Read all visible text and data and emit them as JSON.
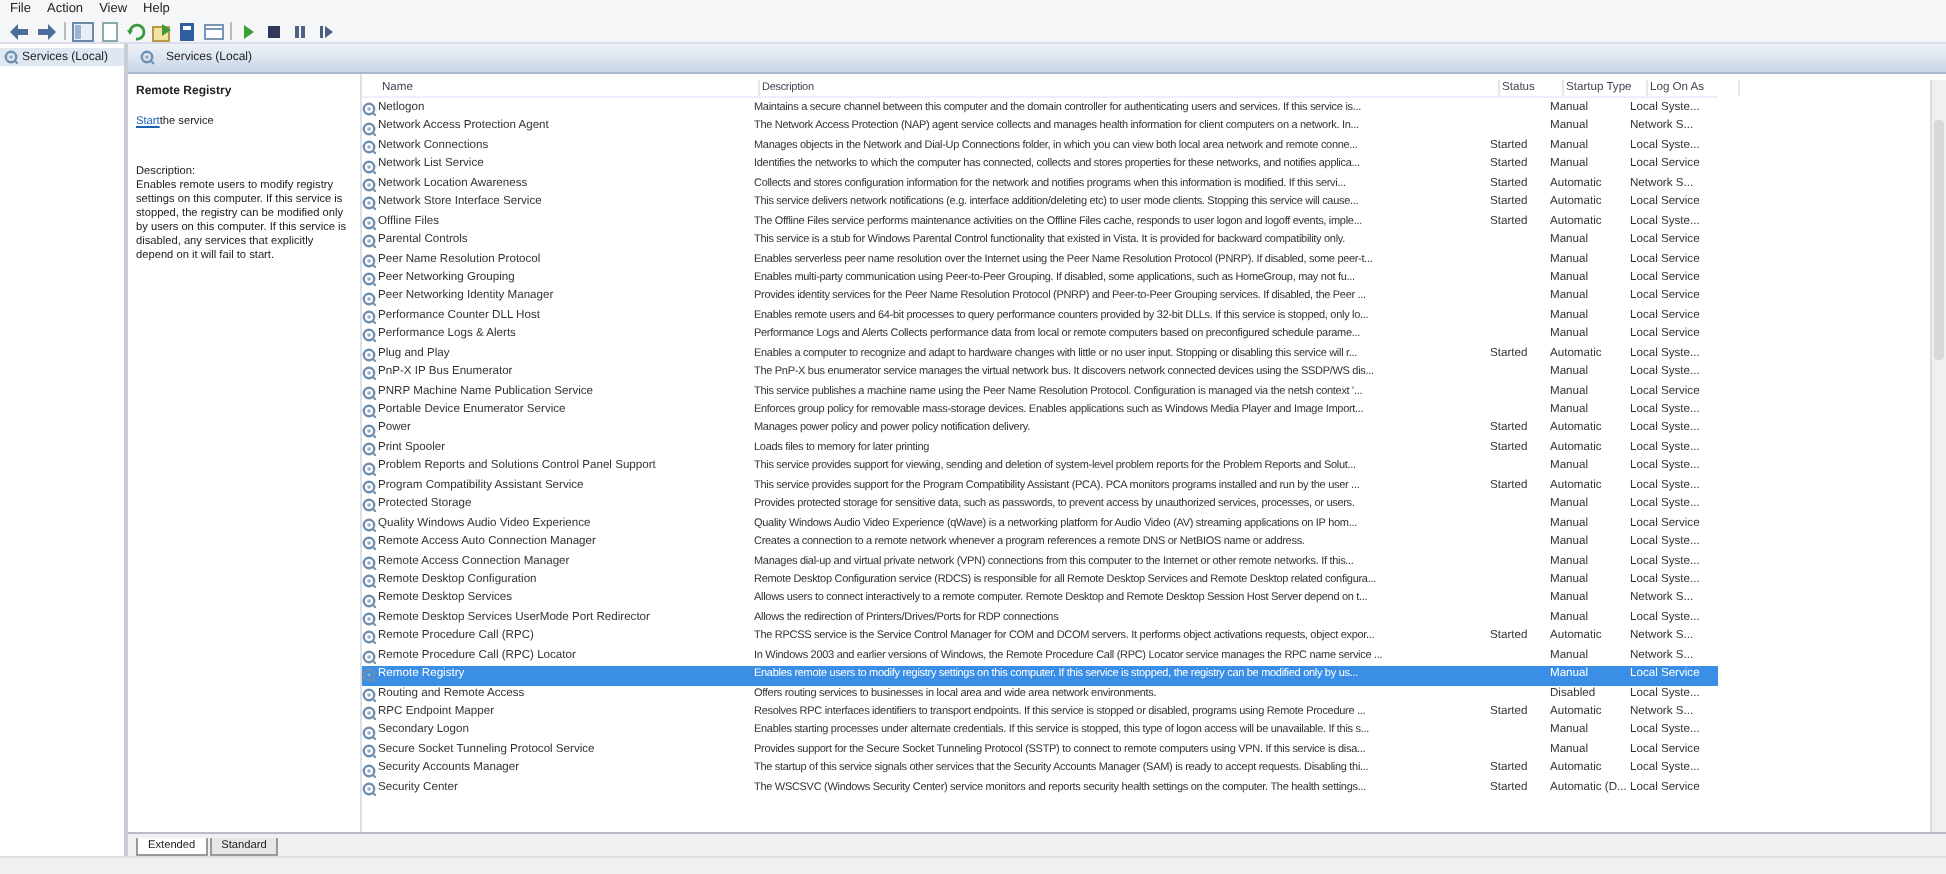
{
  "menu": [
    "File",
    "Action",
    "View",
    "Help"
  ],
  "tree": {
    "label": "Services (Local)",
    "selected": true
  },
  "panel_title": "Services (Local)",
  "details": {
    "title": "Remote Registry",
    "link_prefix": "Start",
    "link_rest": " the service",
    "description_label": "Description:",
    "description": "Enables remote users to modify registry settings on this computer. If this service is stopped, the registry can be modified only by users on this computer. If this service is disabled, any services that explicitly depend on it will fail to start."
  },
  "table": {
    "columns": [
      "Name",
      "Description",
      "Status",
      "Startup Type",
      "Log On As"
    ],
    "rows": [
      {
        "name": "Netlogon",
        "description": "Maintains a secure channel between this computer and the domain controller for authenticating users and services. If this service is...",
        "status": "",
        "startup": "Manual",
        "logon": "Local Syste...",
        "selected": false
      },
      {
        "name": "Network Access Protection Agent",
        "description": "The Network Access Protection (NAP) agent service collects and manages health information for client computers on a network. In...",
        "status": "",
        "startup": "Manual",
        "logon": "Network S...",
        "selected": false
      },
      {
        "name": "Network Connections",
        "description": "Manages objects in the Network and Dial-Up Connections folder, in which you can view both local area network and remote conne...",
        "status": "Started",
        "startup": "Manual",
        "logon": "Local Syste...",
        "selected": false
      },
      {
        "name": "Network List Service",
        "description": "Identifies the networks to which the computer has connected, collects and stores properties for these networks, and notifies applica...",
        "status": "Started",
        "startup": "Manual",
        "logon": "Local Service",
        "selected": false
      },
      {
        "name": "Network Location Awareness",
        "description": "Collects and stores configuration information for the network and notifies programs when this information is modified. If this servi...",
        "status": "Started",
        "startup": "Automatic",
        "logon": "Network S...",
        "selected": false
      },
      {
        "name": "Network Store Interface Service",
        "description": "This service delivers network notifications (e.g. interface addition/deleting etc) to user mode clients. Stopping this service will cause...",
        "status": "Started",
        "startup": "Automatic",
        "logon": "Local Service",
        "selected": false
      },
      {
        "name": "Offline Files",
        "description": "The Offline Files service performs maintenance activities on the Offline Files cache, responds to user logon and logoff events, imple...",
        "status": "Started",
        "startup": "Automatic",
        "logon": "Local Syste...",
        "selected": false
      },
      {
        "name": "Parental Controls",
        "description": "This service is a stub for Windows Parental Control functionality that existed in Vista. It is provided for backward compatibility only.",
        "status": "",
        "startup": "Manual",
        "logon": "Local Service",
        "selected": false
      },
      {
        "name": "Peer Name Resolution Protocol",
        "description": "Enables serverless peer name resolution over the Internet using the Peer Name Resolution Protocol (PNRP). If disabled, some peer-t...",
        "status": "",
        "startup": "Manual",
        "logon": "Local Service",
        "selected": false
      },
      {
        "name": "Peer Networking Grouping",
        "description": "Enables multi-party communication using Peer-to-Peer Grouping. If disabled, some applications, such as HomeGroup, may not fu...",
        "status": "",
        "startup": "Manual",
        "logon": "Local Service",
        "selected": false
      },
      {
        "name": "Peer Networking Identity Manager",
        "description": "Provides identity services for the Peer Name Resolution Protocol (PNRP) and Peer-to-Peer Grouping services. If disabled, the Peer ...",
        "status": "",
        "startup": "Manual",
        "logon": "Local Service",
        "selected": false
      },
      {
        "name": "Performance Counter DLL Host",
        "description": "Enables remote users and 64-bit processes to query performance counters provided by 32-bit DLLs. If this service is stopped, only lo...",
        "status": "",
        "startup": "Manual",
        "logon": "Local Service",
        "selected": false
      },
      {
        "name": "Performance Logs & Alerts",
        "description": "Performance Logs and Alerts Collects performance data from local or remote computers based on preconfigured schedule parame...",
        "status": "",
        "startup": "Manual",
        "logon": "Local Service",
        "selected": false
      },
      {
        "name": "Plug and Play",
        "description": "Enables a computer to recognize and adapt to hardware changes with little or no user input. Stopping or disabling this service will r...",
        "status": "Started",
        "startup": "Automatic",
        "logon": "Local Syste...",
        "selected": false
      },
      {
        "name": "PnP-X IP Bus Enumerator",
        "description": "The PnP-X bus enumerator service manages the virtual network bus. It discovers network connected devices using the SSDP/WS dis...",
        "status": "",
        "startup": "Manual",
        "logon": "Local Syste...",
        "selected": false
      },
      {
        "name": "PNRP Machine Name Publication Service",
        "description": "This service publishes a machine name using the Peer Name Resolution Protocol. Configuration is managed via the netsh context '...",
        "status": "",
        "startup": "Manual",
        "logon": "Local Service",
        "selected": false
      },
      {
        "name": "Portable Device Enumerator Service",
        "description": "Enforces group policy for removable mass-storage devices. Enables applications such as Windows Media Player and Image Import...",
        "status": "",
        "startup": "Manual",
        "logon": "Local Syste...",
        "selected": false
      },
      {
        "name": "Power",
        "description": "Manages power policy and power policy notification delivery.",
        "status": "Started",
        "startup": "Automatic",
        "logon": "Local Syste...",
        "selected": false
      },
      {
        "name": "Print Spooler",
        "description": "Loads files to memory for later printing",
        "status": "Started",
        "startup": "Automatic",
        "logon": "Local Syste...",
        "selected": false
      },
      {
        "name": "Problem Reports and Solutions Control Panel Support",
        "description": "This service provides support for viewing, sending and deletion of system-level problem reports for the Problem Reports and Solut...",
        "status": "",
        "startup": "Manual",
        "logon": "Local Syste...",
        "selected": false
      },
      {
        "name": "Program Compatibility Assistant Service",
        "description": "This service provides support for the Program Compatibility Assistant (PCA). PCA monitors programs installed and run by the user ...",
        "status": "Started",
        "startup": "Automatic",
        "logon": "Local Syste...",
        "selected": false
      },
      {
        "name": "Protected Storage",
        "description": "Provides protected storage for sensitive data, such as passwords, to prevent access by unauthorized services, processes, or users.",
        "status": "",
        "startup": "Manual",
        "logon": "Local Syste...",
        "selected": false
      },
      {
        "name": "Quality Windows Audio Video Experience",
        "description": "Quality Windows Audio Video Experience (qWave) is a networking platform for Audio Video (AV) streaming applications on IP hom...",
        "status": "",
        "startup": "Manual",
        "logon": "Local Service",
        "selected": false
      },
      {
        "name": "Remote Access Auto Connection Manager",
        "description": "Creates a connection to a remote network whenever a program references a remote DNS or NetBIOS name or address.",
        "status": "",
        "startup": "Manual",
        "logon": "Local Syste...",
        "selected": false
      },
      {
        "name": "Remote Access Connection Manager",
        "description": "Manages dial-up and virtual private network (VPN) connections from this computer to the Internet or other remote networks. If this...",
        "status": "",
        "startup": "Manual",
        "logon": "Local Syste...",
        "selected": false
      },
      {
        "name": "Remote Desktop Configuration",
        "description": "Remote Desktop Configuration service (RDCS) is responsible for all Remote Desktop Services and Remote Desktop related configura...",
        "status": "",
        "startup": "Manual",
        "logon": "Local Syste...",
        "selected": false
      },
      {
        "name": "Remote Desktop Services",
        "description": "Allows users to connect interactively to a remote computer. Remote Desktop and Remote Desktop Session Host Server depend on t...",
        "status": "",
        "startup": "Manual",
        "logon": "Network S...",
        "selected": false
      },
      {
        "name": "Remote Desktop Services UserMode Port Redirector",
        "description": "Allows the redirection of Printers/Drives/Ports for RDP connections",
        "status": "",
        "startup": "Manual",
        "logon": "Local Syste...",
        "selected": false
      },
      {
        "name": "Remote Procedure Call (RPC)",
        "description": "The RPCSS service is the Service Control Manager for COM and DCOM servers. It performs object activations requests, object expor...",
        "status": "Started",
        "startup": "Automatic",
        "logon": "Network S...",
        "selected": false
      },
      {
        "name": "Remote Procedure Call (RPC) Locator",
        "description": "In Windows 2003 and earlier versions of Windows, the Remote Procedure Call (RPC) Locator service manages the RPC name service ...",
        "status": "",
        "startup": "Manual",
        "logon": "Network S...",
        "selected": false
      },
      {
        "name": "Remote Registry",
        "description": "Enables remote users to modify registry settings on this computer. If this service is stopped, the registry can be modified only by us...",
        "status": "",
        "startup": "Manual",
        "logon": "Local Service",
        "selected": true
      },
      {
        "name": "Routing and Remote Access",
        "description": "Offers routing services to businesses in local area and wide area network environments.",
        "status": "",
        "startup": "Disabled",
        "logon": "Local Syste...",
        "selected": false
      },
      {
        "name": "RPC Endpoint Mapper",
        "description": "Resolves RPC interfaces identifiers to transport endpoints. If this service is stopped or disabled, programs using Remote Procedure ...",
        "status": "Started",
        "startup": "Automatic",
        "logon": "Network S...",
        "selected": false
      },
      {
        "name": "Secondary Logon",
        "description": "Enables starting processes under alternate credentials. If this service is stopped, this type of logon access will be unavailable. If this s...",
        "status": "",
        "startup": "Manual",
        "logon": "Local Syste...",
        "selected": false
      },
      {
        "name": "Secure Socket Tunneling Protocol Service",
        "description": "Provides support for the Secure Socket Tunneling Protocol (SSTP) to connect to remote computers using VPN. If this service is disa...",
        "status": "",
        "startup": "Manual",
        "logon": "Local Service",
        "selected": false
      },
      {
        "name": "Security Accounts Manager",
        "description": "The startup of this service signals other services that the Security Accounts Manager (SAM) is ready to accept requests. Disabling thi...",
        "status": "Started",
        "startup": "Automatic",
        "logon": "Local Syste...",
        "selected": false
      },
      {
        "name": "Security Center",
        "description": "The WSCSVC (Windows Security Center) service monitors and reports security health settings on the computer. The health settings...",
        "status": "Started",
        "startup": "Automatic (D...",
        "logon": "Local Service",
        "selected": false
      }
    ]
  },
  "view_tabs": [
    {
      "label": "Extended",
      "selected": true
    },
    {
      "label": "Standard",
      "selected": false
    }
  ]
}
